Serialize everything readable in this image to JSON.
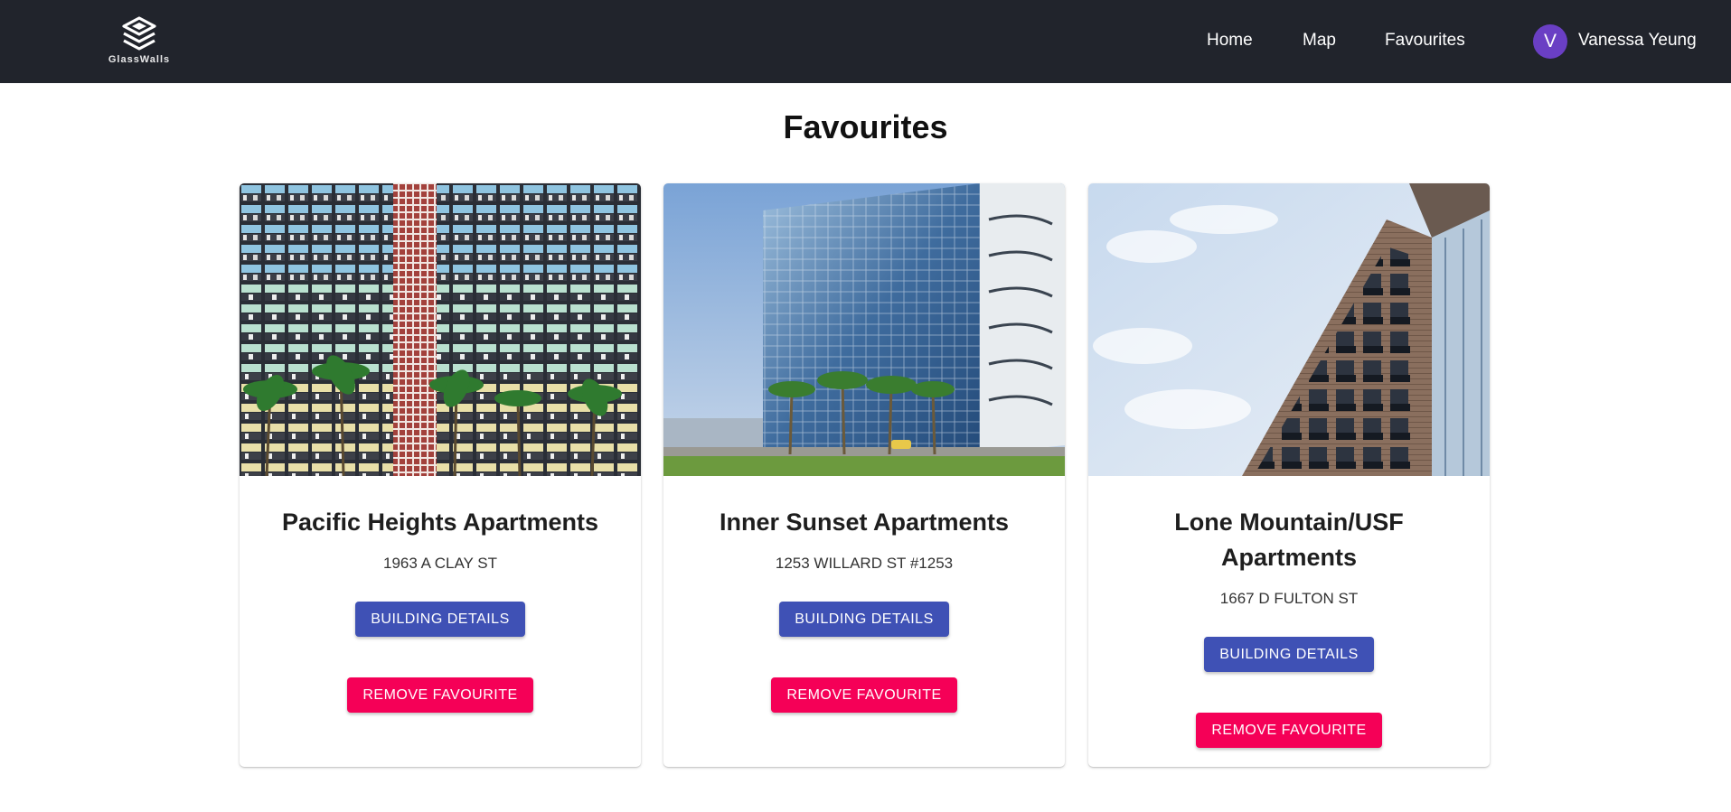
{
  "brand": {
    "name": "GlassWalls",
    "icon": "glasswalls-logo-icon"
  },
  "nav": {
    "links": [
      "Home",
      "Map",
      "Favourites"
    ],
    "user": {
      "initial": "V",
      "name": "Vanessa Yeung",
      "avatar_color": "#6a3fc4"
    }
  },
  "page": {
    "title": "Favourites"
  },
  "colors": {
    "navbar": "#21242c",
    "details_button": "#3f51b5",
    "remove_button": "#f50057"
  },
  "cards": [
    {
      "title": "Pacific Heights Apartments",
      "address": "1963 A CLAY ST",
      "details_label": "BUILDING DETAILS",
      "remove_label": "REMOVE FAVOURITE",
      "image": "colorful-apartment-facade-with-palm-trees"
    },
    {
      "title": "Inner Sunset Apartments",
      "address": "1253 WILLARD ST #1253",
      "details_label": "BUILDING DETAILS",
      "remove_label": "REMOVE FAVOURITE",
      "image": "glass-tower-with-palm-trees"
    },
    {
      "title": "Lone Mountain/USF Apartments",
      "address": "1667 D FULTON ST",
      "details_label": "BUILDING DETAILS",
      "remove_label": "REMOVE FAVOURITE",
      "image": "brick-apartment-building-with-balconies"
    }
  ]
}
